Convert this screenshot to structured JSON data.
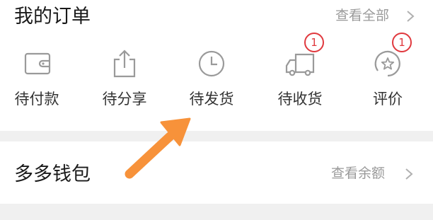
{
  "orders": {
    "title": "我的订单",
    "view_all": "查看全部",
    "items": [
      {
        "label": "待付款",
        "icon": "wallet-icon",
        "badge": ""
      },
      {
        "label": "待分享",
        "icon": "share-icon",
        "badge": ""
      },
      {
        "label": "待发货",
        "icon": "clock-icon",
        "badge": ""
      },
      {
        "label": "待收货",
        "icon": "truck-icon",
        "badge": "1"
      },
      {
        "label": "评价",
        "icon": "review-star-icon",
        "badge": "1"
      }
    ]
  },
  "wallet": {
    "title": "多多钱包",
    "view_balance": "查看余额"
  },
  "colors": {
    "badge": "#e0393e",
    "arrow": "#f7923a",
    "icon_stroke": "#9a9a9a"
  }
}
